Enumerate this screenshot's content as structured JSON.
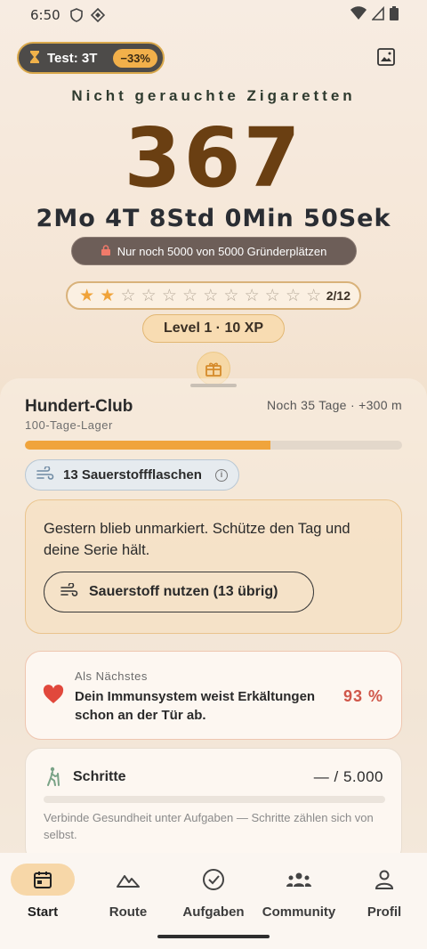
{
  "status_bar": {
    "time": "6:50"
  },
  "test_pill": {
    "label": "Test: 3T",
    "discount": "−33%"
  },
  "counter": {
    "subtitle": "Nicht gerauchte Zigaretten",
    "value": "367",
    "elapsed": "2Mo 4T 8Std 0Min 50Sek"
  },
  "founder": {
    "label": "Nur noch 5000 von 5000 Gründerplätzen"
  },
  "stars": {
    "filled": 2,
    "total": 12,
    "count_label": "2/12"
  },
  "level": {
    "label": "Level 1 · 10 XP"
  },
  "club": {
    "title": "Hundert-Club",
    "subtitle": "100-Tage-Lager",
    "remaining": "Noch 35 Tage · +300 m",
    "progress": 0.65
  },
  "oxygen": {
    "label": "13 Sauerstoffflaschen"
  },
  "warning": {
    "text": "Gestern blieb unmarkiert. Schütze den Tag und deine Serie hält.",
    "button_label": "Sauerstoff nutzen (13 übrig)"
  },
  "next": {
    "label": "Als Nächstes",
    "description": "Dein Immunsystem weist Erkältungen schon an der Tür ab.",
    "percent": "93 %"
  },
  "steps": {
    "title": "Schritte",
    "goal": "— / 5.000",
    "hint": "Verbinde Gesundheit unter Aufgaben — Schritte zählen sich von selbst."
  },
  "nav": {
    "items": [
      {
        "label": "Start",
        "icon": "calendar-icon",
        "active": true
      },
      {
        "label": "Route",
        "icon": "mountain-icon",
        "active": false
      },
      {
        "label": "Aufgaben",
        "icon": "check-circle-icon",
        "active": false
      },
      {
        "label": "Community",
        "icon": "group-icon",
        "active": false
      },
      {
        "label": "Profil",
        "icon": "person-icon",
        "active": false
      }
    ]
  },
  "colors": {
    "accent": "#f0a43c",
    "counter": "#6a3f12",
    "heart": "#e1483c",
    "percent": "#d0574a"
  }
}
